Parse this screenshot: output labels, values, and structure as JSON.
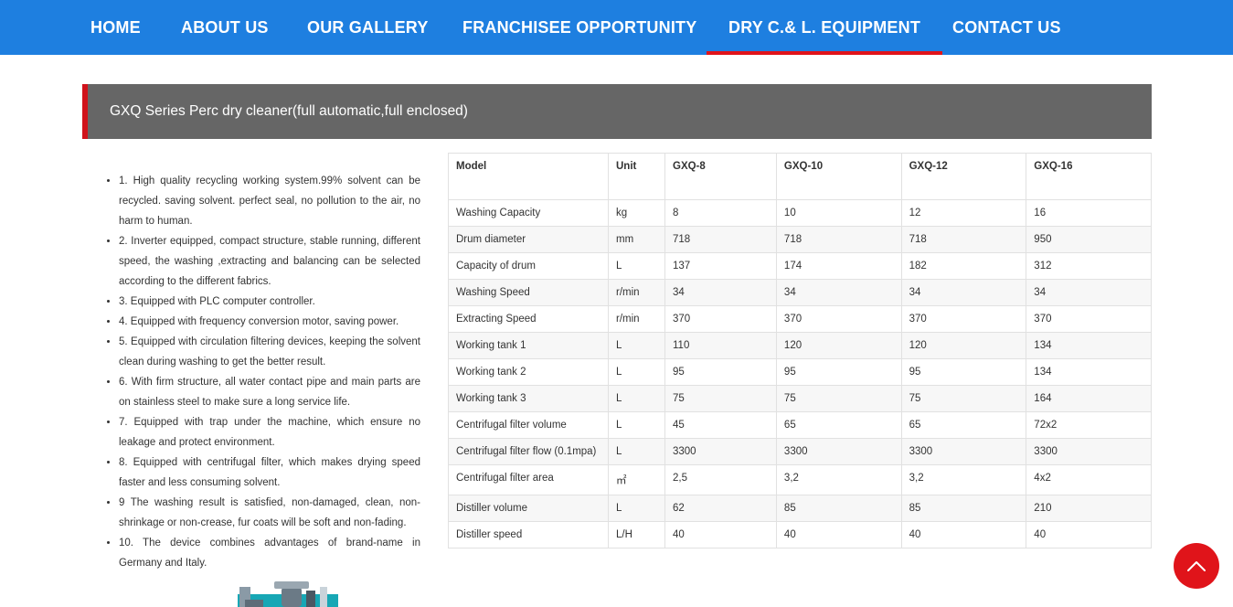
{
  "nav": {
    "items": [
      {
        "label": "HOME"
      },
      {
        "label": "ABOUT US"
      },
      {
        "label": "OUR GALLERY"
      },
      {
        "label": "FRANCHISEE OPPORTUNITY"
      },
      {
        "label": "DRY C.& L. EQUIPMENT"
      },
      {
        "label": "CONTACT US"
      }
    ],
    "active": "DRY C.& L. EQUIPMENT"
  },
  "page_title": "GXQ Series Perc dry cleaner(full automatic,full enclosed)",
  "features": [
    "1. High quality recycling working system.99% solvent can be recycled. saving solvent. perfect seal, no pollution to the air, no harm to human.",
    "2. Inverter equipped, compact structure, stable running, different speed, the washing ,extracting and balancing can be selected according to the different fabrics.",
    "3. Equipped with PLC computer controller.",
    "4. Equipped with frequency conversion motor, saving power.",
    "5. Equipped with circulation filtering devices, keeping the solvent clean during washing to get the better result.",
    "6. With firm structure, all water contact pipe and main parts are on stainless steel to make sure a long service life.",
    "7. Equipped with trap under the machine, which ensure no leakage and protect environment.",
    "8. Equipped with centrifugal filter, which makes drying speed faster and less consuming solvent.",
    "9 The washing result is satisfied, non-damaged, clean, non-shrinkage or non-crease, fur coats will be soft and non-fading.",
    "10. The device combines advantages of brand-name in Germany and Italy."
  ],
  "spec_table": {
    "headers": [
      "Model",
      "Unit",
      "GXQ-8",
      "GXQ-10",
      "GXQ-12",
      "GXQ-16"
    ],
    "rows": [
      [
        "Washing Capacity",
        "kg",
        "8",
        "10",
        "12",
        "16"
      ],
      [
        "Drum diameter",
        "mm",
        "718",
        "718",
        "718",
        "950"
      ],
      [
        "Capacity of drum",
        "L",
        "137",
        "174",
        "182",
        "312"
      ],
      [
        "Washing Speed",
        "r/min",
        "34",
        "34",
        "34",
        "34"
      ],
      [
        "Extracting Speed",
        "r/min",
        "370",
        "370",
        "370",
        "370"
      ],
      [
        "Working tank 1",
        "L",
        "110",
        "120",
        "120",
        "134"
      ],
      [
        "Working tank 2",
        "L",
        "95",
        "95",
        "95",
        "134"
      ],
      [
        "Working tank 3",
        "L",
        "75",
        "75",
        "75",
        "164"
      ],
      [
        "Centrifugal filter volume",
        "L",
        "45",
        "65",
        "65",
        "72x2"
      ],
      [
        "Centrifugal filter flow (0.1mpa)",
        "L",
        "3300",
        "3300",
        "3300",
        "3300"
      ],
      [
        "Centrifugal filter area",
        "㎡",
        "2,5",
        "3,2",
        "3,2",
        "4x2"
      ],
      [
        "Distiller volume",
        "L",
        "62",
        "85",
        "85",
        "210"
      ],
      [
        "Distiller speed",
        "L/H",
        "40",
        "40",
        "40",
        "40"
      ]
    ]
  },
  "icons": {
    "back_to_top": "chevron-up-icon"
  },
  "colors": {
    "nav_bg": "#1e7fe0",
    "accent_red": "#e0141a",
    "title_bar_bg": "#666666"
  }
}
